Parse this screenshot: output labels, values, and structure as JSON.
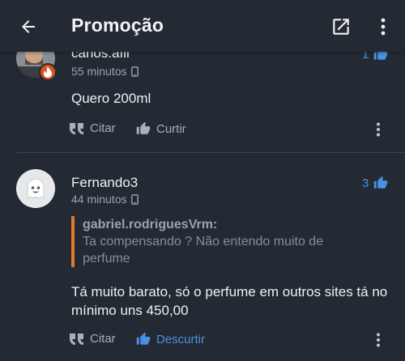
{
  "header": {
    "title": "Promoção"
  },
  "comments": [
    {
      "author": "carlos.afil",
      "time": "55 minutos",
      "likes": "1",
      "text": "Quero 200ml",
      "actions": {
        "quote": "Citar",
        "like": "Curtir"
      }
    },
    {
      "author": "Fernando3",
      "time": "44 minutos",
      "likes": "3",
      "quote": {
        "author": "gabriel.rodriguesVrm:",
        "text": "Ta compensando ? Não entendo muito de perfume"
      },
      "text": "Tá muito barato, só o perfume em outros sites tá no mínimo uns 450,00",
      "actions": {
        "quote": "Citar",
        "like": "Descurtir"
      }
    }
  ],
  "colors": {
    "background": "#232a33",
    "accent": "#4a90e2",
    "quote_bar": "#e07b2e",
    "muted": "#9aa3ad"
  }
}
